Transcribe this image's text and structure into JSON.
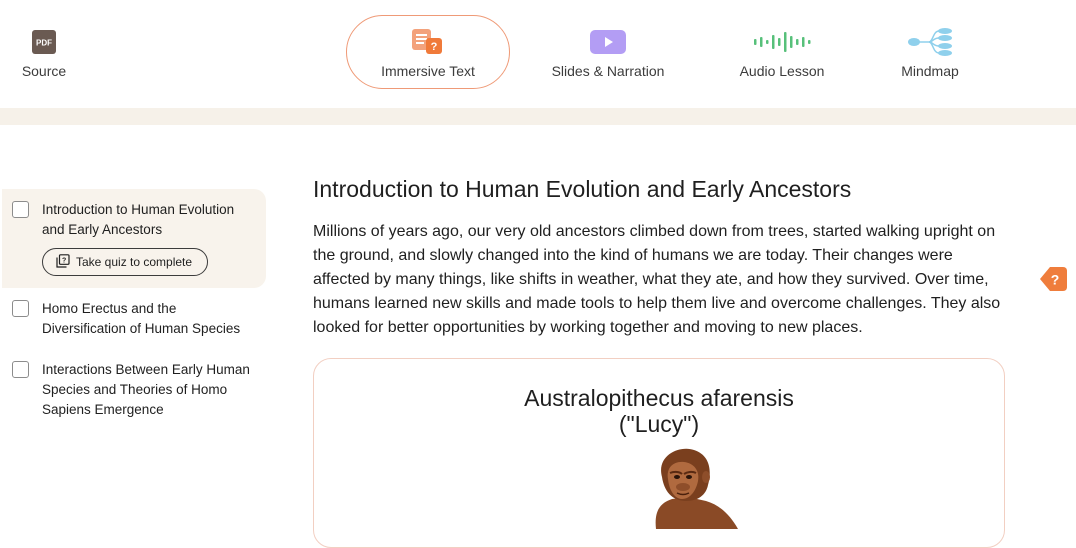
{
  "toolbar": {
    "tabs": [
      {
        "label": "Source",
        "icon": "pdf-icon",
        "icon_text": "PDF"
      },
      {
        "label": "Immersive Text",
        "icon": "immersive-text-icon",
        "active": true
      },
      {
        "label": "Slides & Narration",
        "icon": "play-icon"
      },
      {
        "label": "Audio Lesson",
        "icon": "audio-wave-icon"
      },
      {
        "label": "Mindmap",
        "icon": "mindmap-icon"
      }
    ]
  },
  "sidebar": {
    "items": [
      {
        "label": "Introduction to Human Evolution and Early Ancestors",
        "active": true,
        "quiz_label": "Take quiz to complete"
      },
      {
        "label": "Homo Erectus and the Diversification of Human Species"
      },
      {
        "label": "Interactions Between Early Human Species and Theories of Homo Sapiens Emergence"
      }
    ]
  },
  "main": {
    "title": "Introduction to Human Evolution and Early Ancestors",
    "paragraph": "Millions of years ago, our very old ancestors climbed down from trees, started walking upright on the ground, and slowly changed into the kind of humans we are today. Their changes were affected by many things, like shifts in weather, what they ate, and how they survived. Over time, humans learned new skills and made tools to help them live and overcome challenges. They also looked for better opportunities by working together and moving to new places.",
    "figure": {
      "title_line1": "Australopithecus afarensis",
      "title_line2": "(\"Lucy\")"
    }
  },
  "help": {
    "icon": "question-icon",
    "glyph": "?"
  },
  "colors": {
    "accent": "#ef7d3c",
    "accent_border": "#ef9a77",
    "band": "#f6f1e9",
    "active_item_bg": "#f8f3ec",
    "slides_icon": "#b39df4",
    "audio_icon": "#57c07a",
    "mindmap_icon": "#8fd0ec"
  }
}
